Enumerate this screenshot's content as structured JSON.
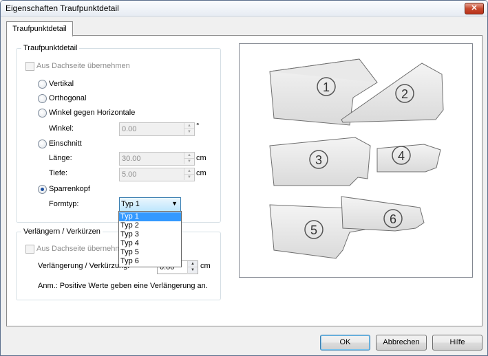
{
  "window": {
    "title": "Eigenschaften Traufpunktdetail",
    "close_label": "✕"
  },
  "tabs": [
    {
      "label": "Traufpunktdetail"
    }
  ],
  "group1": {
    "title": "Traufpunktdetail",
    "from_roof_label": "Aus Dachseite übernehmen",
    "options": {
      "vertikal": "Vertikal",
      "orthogonal": "Orthogonal",
      "winkel_horiz": "Winkel gegen Horizontale",
      "einschnitt": "Einschnitt",
      "sparrenkopf": "Sparrenkopf"
    },
    "selected_option": "Sparrenkopf",
    "winkel": {
      "label": "Winkel:",
      "value": "0.00",
      "unit": "°"
    },
    "laenge": {
      "label": "Länge:",
      "value": "30.00",
      "unit": "cm"
    },
    "tiefe": {
      "label": "Tiefe:",
      "value": "5.00",
      "unit": "cm"
    },
    "formtyp": {
      "label": "Formtyp:",
      "value": "Typ 1"
    }
  },
  "dropdown": {
    "options": [
      "Typ 1",
      "Typ 2",
      "Typ 3",
      "Typ 4",
      "Typ 5",
      "Typ 6"
    ],
    "selected": "Typ 1"
  },
  "group2": {
    "title": "Verlängern / Verkürzen",
    "from_roof_label": "Aus Dachseite übernehm",
    "ext_label": "Verlängerung / Verkürzung:",
    "ext_value": "0.00",
    "ext_unit": "cm",
    "note": "Anm.: Positive Werte geben eine Verlängerung an."
  },
  "preview": {
    "labels": [
      "1",
      "2",
      "3",
      "4",
      "5",
      "6"
    ]
  },
  "buttons": {
    "ok": "OK",
    "cancel": "Abbrechen",
    "help": "Hilfe"
  },
  "colors": {
    "selection": "#3399ff",
    "accent": "#3c7fb1",
    "close": "#c74a2f"
  }
}
